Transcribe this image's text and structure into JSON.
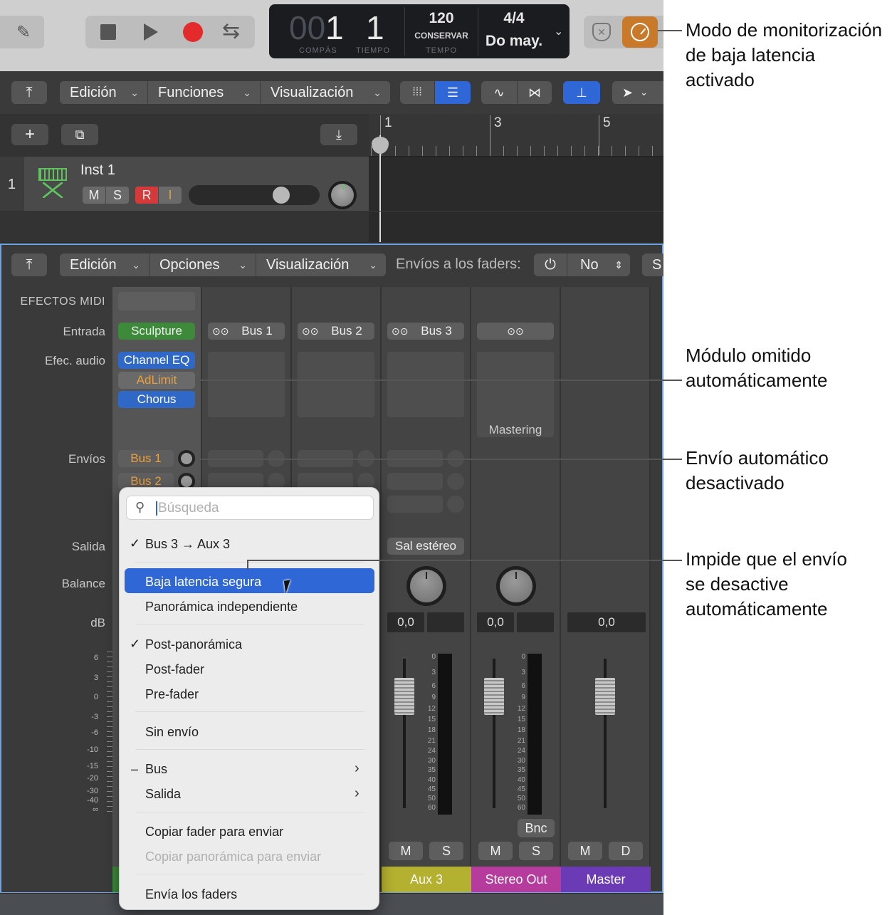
{
  "transport": {
    "bar": "1",
    "bar_dim": "00",
    "beat": "1",
    "bar_label": "COMPÁS",
    "beat_label": "TIEMPO",
    "tempo": "120",
    "tempo_mode": "CONSERVAR",
    "tempo_label": "TEMPO",
    "signature": "4/4",
    "key": "Do may."
  },
  "tracks_toolbar": {
    "edit": "Edición",
    "functions": "Funciones",
    "view": "Visualización"
  },
  "ruler": {
    "marks": [
      "1",
      "3",
      "5"
    ]
  },
  "track": {
    "number": "1",
    "name": "Inst 1",
    "mute": "M",
    "solo": "S",
    "record": "R",
    "input": "I"
  },
  "mixer_toolbar": {
    "edit": "Edición",
    "options": "Opciones",
    "view": "Visualización",
    "sends_label": "Envíos a los faders:",
    "sends_value": "No",
    "cut_text": "S"
  },
  "row_labels": {
    "midi_fx": "EFECTOS MIDI",
    "input": "Entrada",
    "audio_fx": "Efec. audio",
    "sends": "Envíos",
    "output": "Salida",
    "balance": "Balance",
    "db": "dB"
  },
  "strip1": {
    "input": "Sculpture",
    "plugins": [
      "Channel EQ",
      "AdLimit",
      "Chorus"
    ],
    "sends": [
      "Bus 1",
      "Bus 2"
    ]
  },
  "strips": {
    "inputs": [
      "Bus 1",
      "Bus 2",
      "Bus 3"
    ],
    "mastering": "Mastering",
    "output_aux3": "Sal estéreo",
    "db_aux3": "0,0",
    "db_stereo": "0,0",
    "db_master": "0,0",
    "bnc": "Bnc",
    "mute": "M",
    "solo": "S",
    "dim": "D",
    "names": {
      "aux3": "Aux 3",
      "stereo": "Stereo Out",
      "master": "Master"
    }
  },
  "scale_left": [
    "6",
    "3",
    "0",
    "-3",
    "-6",
    "-10",
    "-15",
    "-20",
    "-30",
    "-40",
    "∞"
  ],
  "scale_meter": [
    "0",
    "3",
    "6",
    "9",
    "12",
    "15",
    "18",
    "21",
    "24",
    "30",
    "35",
    "40",
    "45",
    "50",
    "60"
  ],
  "popup": {
    "search_placeholder": "Búsqueda",
    "current_route": "Bus 3 → Aux 3",
    "items": {
      "low_latency": "Baja latencia segura",
      "independent_pan": "Panorámica independiente",
      "post_pan": "Post-panorámica",
      "post_fader": "Post-fader",
      "pre_fader": "Pre-fader",
      "no_send": "Sin envío",
      "bus": "Bus",
      "output": "Salida",
      "copy_fader": "Copiar fader para enviar",
      "copy_pan": "Copiar panorámica para enviar",
      "send_faders": "Envía los faders"
    },
    "check_mark": "✓",
    "dash_mark": "–"
  },
  "annotations": {
    "low_latency_mode": "Modo de monitorización de baja latencia activado",
    "bypassed_plugin": "Módulo omitido automáticamente",
    "send_muted": "Envío automático desactivado",
    "prevents_mute": "Impide que el envío se desactive automáticamente"
  },
  "colors": {
    "orange_accent": "#c87a2a",
    "blue_accent": "#2f68d6",
    "sculpture_green": "#3d8a3a",
    "aux_yellow": "#b4b030",
    "stereo_magenta": "#b53b9c",
    "master_purple": "#6a3bb5"
  }
}
